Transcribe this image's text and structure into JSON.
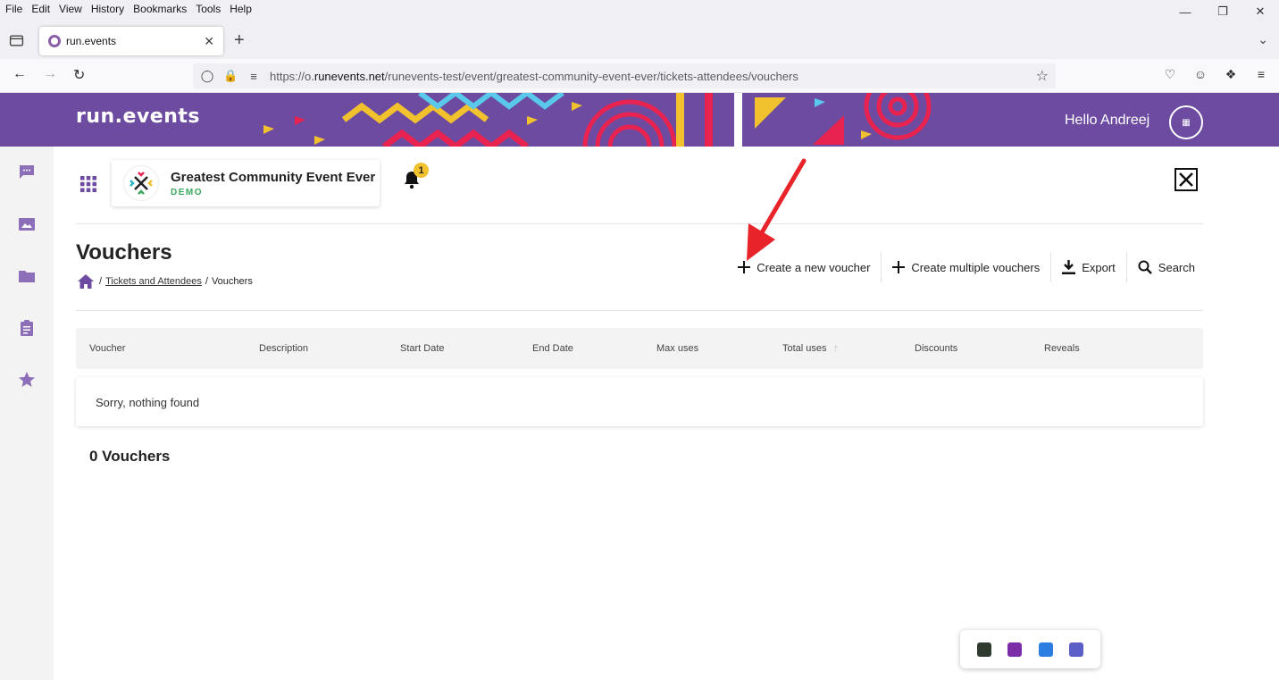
{
  "browser": {
    "menu": [
      "File",
      "Edit",
      "View",
      "History",
      "Bookmarks",
      "Tools",
      "Help"
    ],
    "tab_title": "run.events",
    "url_prefix": "https://o.",
    "url_host": "runevents.net",
    "url_path": "/runevents-test/event/greatest-community-event-ever/tickets-attendees/vouchers"
  },
  "header": {
    "logo": "run.events",
    "greeting": "Hello Andreej"
  },
  "event": {
    "name": "Greatest Community Event Ever",
    "tag": "DEMO",
    "notification_count": "1"
  },
  "page": {
    "title": "Vouchers",
    "breadcrumb": {
      "level1": "Tickets and Attendees",
      "current": "Vouchers"
    }
  },
  "actions": {
    "create_new": "Create a new voucher",
    "create_multiple": "Create multiple vouchers",
    "export": "Export",
    "search": "Search"
  },
  "table": {
    "columns": [
      "Voucher",
      "Description",
      "Start Date",
      "End Date",
      "Max uses",
      "Total uses",
      "Discounts",
      "Reveals"
    ],
    "empty_message": "Sorry, nothing found",
    "count_label": "0 Vouchers"
  },
  "colors": {
    "brand_purple": "#6c4ba0",
    "accent_red": "#e8232a",
    "demo_green": "#3aa85b",
    "badge_yellow": "#f2c12e"
  }
}
